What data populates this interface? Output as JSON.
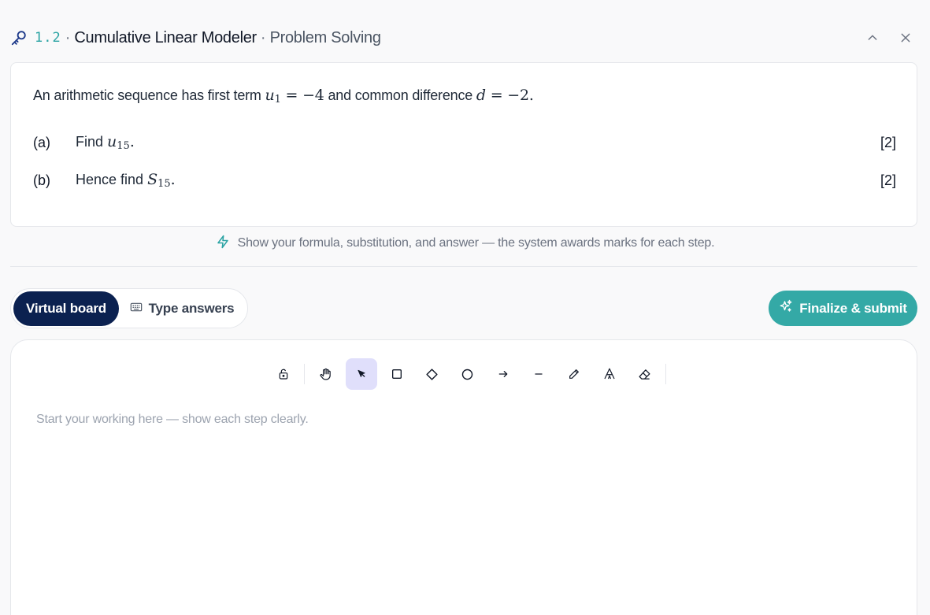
{
  "header": {
    "number": "1.2",
    "separator": "·",
    "title": "Cumulative Linear Modeler",
    "subtitle": "Problem Solving",
    "icons": {
      "lead": "key-icon",
      "collapse": "chevron-up-icon",
      "close": "close-icon"
    }
  },
  "question": {
    "stem_prefix": "An arithmetic sequence has first term",
    "stem_term_var": "u",
    "stem_term_sub": "1",
    "stem_term_eq": "= −4",
    "stem_middle": "and common difference",
    "stem_diff_var": "d",
    "stem_diff_eq": "= −2.",
    "parts": [
      {
        "label": "(a)",
        "text": "Find",
        "var": "u",
        "sub": "15",
        "suffix": ".",
        "marks": "[2]"
      },
      {
        "label": "(b)",
        "text": "Hence find",
        "var": "S",
        "sub": "15",
        "suffix": ".",
        "marks": "[2]"
      }
    ]
  },
  "hint": {
    "icon": "lightning-icon",
    "text": "Show your formula, substitution, and answer — the system awards marks for each step."
  },
  "tabs": [
    {
      "label": "Virtual board",
      "active": true
    },
    {
      "label": "Type answers",
      "active": false,
      "icon": "keyboard-icon"
    }
  ],
  "submit": {
    "label": "Finalize & submit",
    "icon": "sparkles-icon"
  },
  "board": {
    "placeholder": "Start your working here — show each step clearly.",
    "tools": [
      "lock-icon",
      "hand-icon",
      "pointer-icon",
      "rectangle-icon",
      "diamond-icon",
      "ellipse-icon",
      "arrow-icon",
      "line-icon",
      "pencil-icon",
      "text-icon",
      "eraser-icon"
    ],
    "active_tool": "pointer-icon"
  },
  "colors": {
    "accent": "#34a9a6",
    "navy": "#0b2150",
    "number": "#2aa3a3",
    "active_tool_bg": "#e0dffb"
  }
}
